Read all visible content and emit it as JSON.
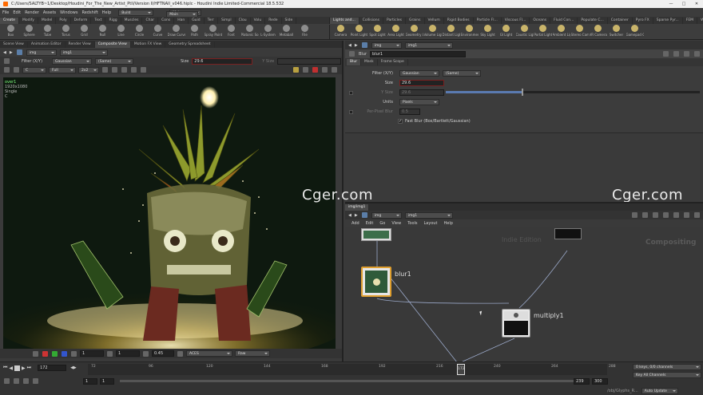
{
  "window": {
    "title": "C:/Users/SALTYB~1/Desktop/Houdini_For_The_New_Artist_Ptll/Version II/HFTNAII_v046.hiplc - Houdini Indie Limited-Commercial 18.5.532"
  },
  "menubar": {
    "items": [
      "File",
      "Edit",
      "Render",
      "Assets",
      "Windows",
      "Redshift",
      "Help"
    ],
    "build": "Build",
    "main": "Main",
    "desktop": "Main"
  },
  "shelf_tabs_left": [
    "Create",
    "Modify",
    "Model",
    "Poly",
    "Deform",
    "Text",
    "Rigg",
    "Muscles",
    "Char",
    "Cons",
    "Han",
    "Guid",
    "Terr",
    "Simpl",
    "Clou",
    "Volu",
    "Rede",
    "Side"
  ],
  "shelf_tools_left": [
    "Box",
    "Sphere",
    "Tube",
    "Torus",
    "Grid",
    "Null",
    "Line",
    "Circle",
    "Curve",
    "Draw Curve",
    "Path",
    "Spray Paint",
    "Font",
    "Platonic Solids",
    "L-System",
    "Metaball",
    "File"
  ],
  "shelf_tabs_right": [
    "Lights and...",
    "Collisions",
    "Particles",
    "Grains",
    "Vellum",
    "Rigid Bodies",
    "Particle Fl...",
    "Viscous Fl...",
    "Oceans",
    "Fluid Con...",
    "Populate C...",
    "Container",
    "Pyro FX",
    "Sparse Pyr...",
    "FEM",
    "Wires",
    "Crowds",
    "Drive Sim"
  ],
  "shelf_tools_right": [
    "Camera",
    "Point Light",
    "Spot Light",
    "Area Light",
    "Geometry Light",
    "Volume Light",
    "Distant Light",
    "Environment Light",
    "Sky Light",
    "GI Light",
    "Caustic Light",
    "Portal Light",
    "Ambient Light",
    "Stereo Camera",
    "VR Camera",
    "Switcher",
    "Gamepad Camera"
  ],
  "left_panel": {
    "tabs": [
      "Scene View",
      "Animation Editor",
      "Render View",
      "Composite View",
      "Motion FX View",
      "Geometry Spreadsheet"
    ],
    "path": [
      "img",
      "img1"
    ],
    "filter_label": "Filter (X/Y)",
    "filter_value": "Gaussian",
    "same_value": "(Same)",
    "size_label": "Size",
    "size_value": "29.6",
    "ysize_label": "Y Size",
    "view_c": "C",
    "view_full": "Full",
    "view_2x2": "2x2",
    "overlay": [
      "over1",
      "1920x1080",
      "Single",
      "C"
    ],
    "bottom_frame": "1",
    "bottom_frame2": "1",
    "bottom_gamma": "0.45",
    "bottom_lut": "ACES",
    "bottom_raw": "Raw"
  },
  "param_panel": {
    "path": [
      "img",
      "img1"
    ],
    "node_type": "Blur",
    "node_name": "blur1",
    "tabs": [
      "Blur",
      "Mask",
      "Frame Scope"
    ],
    "rows": [
      {
        "label": "Filter (X/Y)",
        "value": "Gaussian",
        "extra": "(Same)"
      },
      {
        "label": "Size",
        "value": "29.6"
      },
      {
        "label": "Y Size",
        "value": "29.6"
      },
      {
        "label": "Units",
        "value": "Pixels"
      },
      {
        "label": "Per-Pixel Blur",
        "value": "0.5"
      }
    ],
    "checkbox_label": "Fast Blur (Box/Bartlett/Gaussian)",
    "slider_fraction": 0.3
  },
  "network": {
    "tab": "img/img1",
    "path": [
      "img",
      "img1"
    ],
    "menu": [
      "Add",
      "Edit",
      "Go",
      "View",
      "Tools",
      "Layout",
      "Help"
    ],
    "watermark_edition": "Indie Edition",
    "watermark_context": "Compositing",
    "nodes": {
      "blur": "blur1",
      "multiply": "multiply1"
    }
  },
  "timeline": {
    "frame": "172",
    "ticks": [
      "72",
      "96",
      "120",
      "144",
      "168",
      "192",
      "216",
      "240",
      "264",
      "288"
    ],
    "start": "1",
    "start2": "1",
    "end": "239",
    "end2": "300",
    "current_marker": "172",
    "keys_label": "0 keys, 0/0 channels",
    "key_all": "Key All Channels",
    "auto_update": "Auto Update",
    "status_path": "/obj/Glyphs_R..."
  },
  "watermarks": [
    "Cger.com",
    "Cger.com"
  ],
  "colors": {
    "accent_orange": "#e0a030",
    "viewport_bg": "#0e1a10",
    "network_bg": "#393939"
  }
}
